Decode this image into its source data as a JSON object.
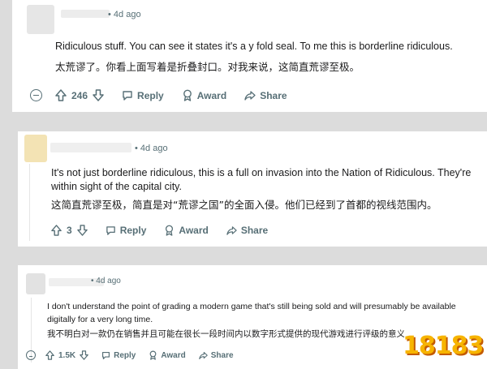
{
  "comments": [
    {
      "time": "4d ago",
      "text_en": "Ridiculous stuff. You can see it states it's a y fold seal. To me this is borderline ridiculous.",
      "text_zh": "太荒谬了。你看上面写着是折叠封口。对我来说，这简直荒谬至极。",
      "votes": "246",
      "reply_label": "Reply",
      "award_label": "Award",
      "share_label": "Share"
    },
    {
      "time": "4d ago",
      "text_en_line1": "It's not just borderline ridiculous, this is a full on invasion into the Nation of Ridiculous. They're",
      "text_en_line2": "within sight of the capital city.",
      "text_zh": "这简直荒谬至极，简直是对“荒谬之国”的全面入侵。他们已经到了首都的视线范围内。",
      "votes": "3",
      "reply_label": "Reply",
      "award_label": "Award",
      "share_label": "Share"
    },
    {
      "time": "4d ago",
      "text_en_line1": "I don't understand the point of grading a modern game that's still being sold and will presumably be available",
      "text_en_line2": "digitally for a very long time.",
      "text_zh": "我不明白对一款仍在销售并且可能在很长一段时间内以数字形式提供的现代游戏进行评级的意义",
      "votes": "1.5K",
      "reply_label": "Reply",
      "award_label": "Award",
      "share_label": "Share"
    }
  ],
  "watermark": {
    "text": "18183"
  },
  "colors": {
    "meta": "#576f76",
    "background": "#dcdcdc",
    "watermark": "#f7b400"
  }
}
